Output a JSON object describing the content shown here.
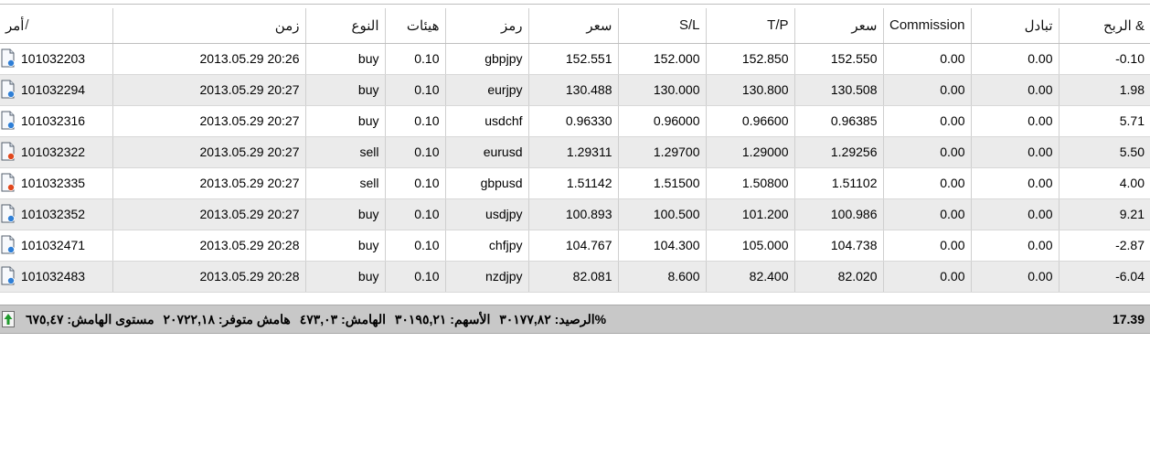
{
  "columns": {
    "order": "أمر",
    "order_sort": "/",
    "time": "زمن",
    "type": "النوع",
    "size": "هيئات",
    "symbol": "رمز",
    "price_open": "سعر",
    "sl": "S/L",
    "tp": "T/P",
    "price_current": "سعر",
    "commission": "Commission",
    "swap": "تبادل",
    "profit": "الربح &"
  },
  "rows": [
    {
      "order": "101032203",
      "time": "2013.05.29 20:26",
      "type": "buy",
      "size": "0.10",
      "symbol": "gbpjpy",
      "price_open": "152.551",
      "sl": "152.000",
      "tp": "152.850",
      "price_current": "152.550",
      "commission": "0.00",
      "swap": "0.00",
      "profit": "-0.10"
    },
    {
      "order": "101032294",
      "time": "2013.05.29 20:27",
      "type": "buy",
      "size": "0.10",
      "symbol": "eurjpy",
      "price_open": "130.488",
      "sl": "130.000",
      "tp": "130.800",
      "price_current": "130.508",
      "commission": "0.00",
      "swap": "0.00",
      "profit": "1.98"
    },
    {
      "order": "101032316",
      "time": "2013.05.29 20:27",
      "type": "buy",
      "size": "0.10",
      "symbol": "usdchf",
      "price_open": "0.96330",
      "sl": "0.96000",
      "tp": "0.96600",
      "price_current": "0.96385",
      "commission": "0.00",
      "swap": "0.00",
      "profit": "5.71"
    },
    {
      "order": "101032322",
      "time": "2013.05.29 20:27",
      "type": "sell",
      "size": "0.10",
      "symbol": "eurusd",
      "price_open": "1.29311",
      "sl": "1.29700",
      "tp": "1.29000",
      "price_current": "1.29256",
      "commission": "0.00",
      "swap": "0.00",
      "profit": "5.50"
    },
    {
      "order": "101032335",
      "time": "2013.05.29 20:27",
      "type": "sell",
      "size": "0.10",
      "symbol": "gbpusd",
      "price_open": "1.51142",
      "sl": "1.51500",
      "tp": "1.50800",
      "price_current": "1.51102",
      "commission": "0.00",
      "swap": "0.00",
      "profit": "4.00"
    },
    {
      "order": "101032352",
      "time": "2013.05.29 20:27",
      "type": "buy",
      "size": "0.10",
      "symbol": "usdjpy",
      "price_open": "100.893",
      "sl": "100.500",
      "tp": "101.200",
      "price_current": "100.986",
      "commission": "0.00",
      "swap": "0.00",
      "profit": "9.21"
    },
    {
      "order": "101032471",
      "time": "2013.05.29 20:28",
      "type": "buy",
      "size": "0.10",
      "symbol": "chfjpy",
      "price_open": "104.767",
      "sl": "104.300",
      "tp": "105.000",
      "price_current": "104.738",
      "commission": "0.00",
      "swap": "0.00",
      "profit": "-2.87"
    },
    {
      "order": "101032483",
      "time": "2013.05.29 20:28",
      "type": "buy",
      "size": "0.10",
      "symbol": "nzdjpy",
      "price_open": "82.081",
      "sl": "8.600",
      "tp": "82.400",
      "price_current": "82.020",
      "commission": "0.00",
      "swap": "0.00",
      "profit": "-6.04"
    }
  ],
  "footer": {
    "balance": "%الرصيد: ٣٠١٧٧,٨٢",
    "equity": "الأسهم: ٣٠١٩٥,٢١",
    "margin": "الهامش: ٤٧٣,٠٣",
    "free_margin": "هامش متوفر: ٢٠٧٢٢,١٨",
    "margin_level": "مستوى الهامش: ٦٧٥,٤٧",
    "total_profit": "17.39"
  },
  "colors": {
    "buy_icon": "#2f7fd6",
    "sell_icon": "#e0481e",
    "footer_bg": "#c8c8c8",
    "row_alt": "#ebebeb",
    "arrow_green": "#1f9a2d"
  },
  "icons": {
    "buy": "document-buy-icon",
    "sell": "document-sell-icon",
    "footer": "green-up-arrow-icon"
  }
}
